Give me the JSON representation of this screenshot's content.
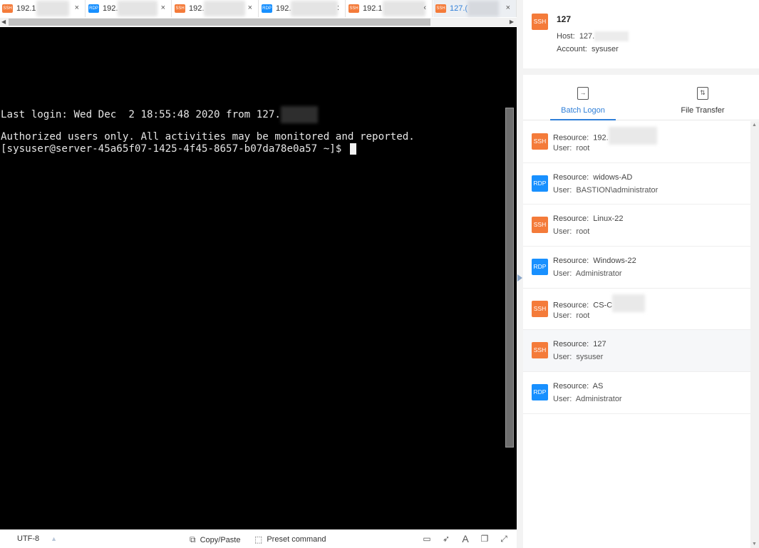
{
  "session_tabs": [
    {
      "type": "SSH",
      "label": "192.1",
      "active": false
    },
    {
      "type": "RDP",
      "label": "192.",
      "active": false
    },
    {
      "type": "SSH",
      "label": "192.",
      "active": false
    },
    {
      "type": "RDP",
      "label": "192.",
      "active": false
    },
    {
      "type": "SSH",
      "label": "192.1",
      "active": false
    },
    {
      "type": "SSH",
      "label": "127.(",
      "active": true
    }
  ],
  "tab_close_glyphs": [
    "×",
    "×",
    "×",
    ":",
    "‹",
    "×"
  ],
  "terminal": {
    "last_login": "Last login: Wed Dec  2 18:55:48 2020 from 127.",
    "notice": "Authorized users only. All activities may be monitored and reported.",
    "prompt": "[sysuser@server-45a65f07-1425-4f45-8657-b07da78e0a57 ~]$ "
  },
  "bottom_bar": {
    "encoding": "UTF-8",
    "copy_paste": "Copy/Paste",
    "preset_command": "Preset command"
  },
  "session_info": {
    "badge": "SSH",
    "name": "127",
    "host_label": "Host:",
    "host_value": "127.",
    "account_label": "Account:",
    "account_value": "sysuser"
  },
  "panel_tabs": {
    "batch_logon": "Batch Logon",
    "file_transfer": "File Transfer"
  },
  "resources": [
    {
      "type": "SSH",
      "resource": "192.",
      "user": "root",
      "blurred": true
    },
    {
      "type": "RDP",
      "resource": "widows-AD",
      "user": "BASTION\\administrator",
      "blurred": false
    },
    {
      "type": "SSH",
      "resource": "Linux-22",
      "user": "root",
      "blurred": false
    },
    {
      "type": "RDP",
      "resource": "Windows-22",
      "user": "Administrator",
      "blurred": false
    },
    {
      "type": "SSH",
      "resource": "CS-C",
      "user": "root",
      "blurred": true
    },
    {
      "type": "SSH",
      "resource": "127",
      "user": "sysuser",
      "blurred": false,
      "selected": true
    },
    {
      "type": "RDP",
      "resource": "AS",
      "user": "Administrator",
      "blurred": false
    }
  ],
  "labels": {
    "resource": "Resource:",
    "user": "User:"
  },
  "colors": {
    "ssh": "#f47b3a",
    "rdp": "#1890ff",
    "accent": "#2f7fd8",
    "terminal_bg": "#000000"
  }
}
